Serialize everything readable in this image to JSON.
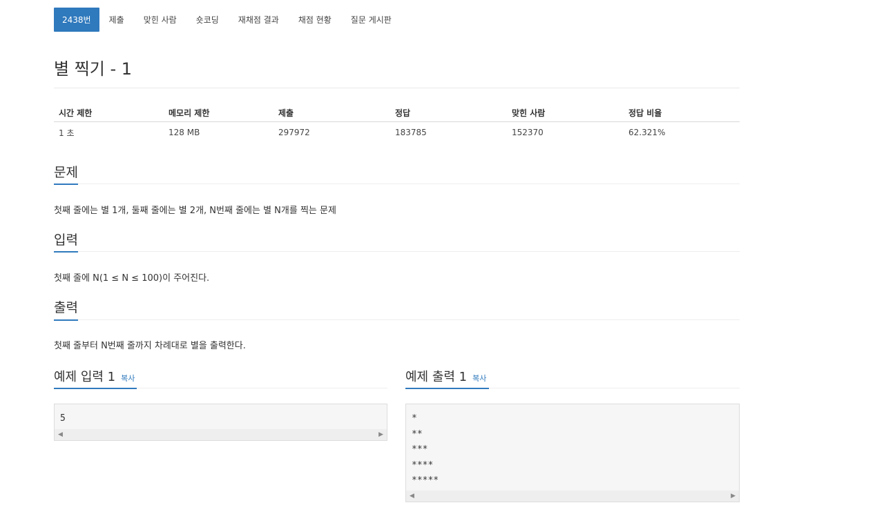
{
  "nav": {
    "tabs": [
      {
        "label": "2438번",
        "active": true
      },
      {
        "label": "제출"
      },
      {
        "label": "맞힌 사람"
      },
      {
        "label": "숏코딩"
      },
      {
        "label": "재채점 결과"
      },
      {
        "label": "채점 현황"
      },
      {
        "label": "질문 게시판"
      }
    ]
  },
  "problem": {
    "title": "별 찍기 - 1"
  },
  "info": {
    "headers": [
      "시간 제한",
      "메모리 제한",
      "제출",
      "정답",
      "맞힌 사람",
      "정답 비율"
    ],
    "values": [
      "1 초",
      "128 MB",
      "297972",
      "183785",
      "152370",
      "62.321%"
    ]
  },
  "sections": {
    "description": {
      "heading": "문제",
      "text": "첫째 줄에는 별 1개, 둘째 줄에는 별 2개, N번째 줄에는 별 N개를 찍는 문제"
    },
    "input": {
      "heading": "입력",
      "text": "첫째 줄에 N(1 ≤ N ≤ 100)이 주어진다."
    },
    "output": {
      "heading": "출력",
      "text": "첫째 줄부터 N번째 줄까지 차례대로 별을 출력한다."
    }
  },
  "samples": {
    "input": {
      "heading": "예제 입력 1",
      "copy_label": "복사",
      "lines": [
        "5"
      ]
    },
    "output": {
      "heading": "예제 출력 1",
      "copy_label": "복사",
      "lines": [
        "*",
        "**",
        "***",
        "****",
        "*****"
      ]
    }
  },
  "colors": {
    "accent": "#2f79bd"
  }
}
